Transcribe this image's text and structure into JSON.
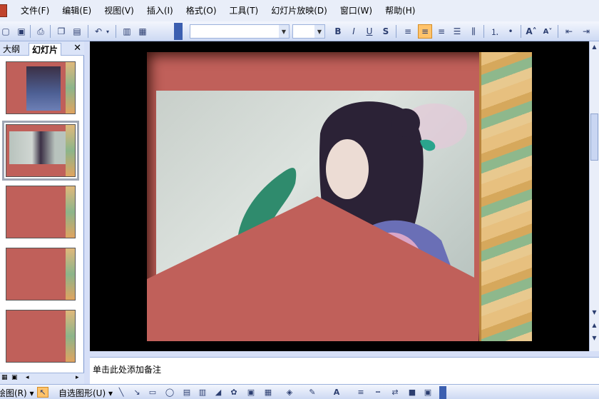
{
  "menubar": {
    "items": [
      "文件(F)",
      "编辑(E)",
      "视图(V)",
      "插入(I)",
      "格式(O)",
      "工具(T)",
      "幻灯片放映(D)",
      "窗口(W)",
      "帮助(H)"
    ]
  },
  "toolbar": {
    "font_name_value": "",
    "font_size_value": "",
    "buttons": [
      "new-icon",
      "open-icon",
      "print-icon",
      "copy-icon",
      "paste-icon",
      "undo-icon",
      "chart-icon",
      "table-icon",
      "bold-icon",
      "italic-icon",
      "underline-icon",
      "shadow-icon",
      "align-left-icon",
      "align-center-icon",
      "align-right-icon",
      "justify-icon",
      "distribute-icon",
      "numbering-icon",
      "bullets-icon",
      "increase-font-icon",
      "decrease-font-icon",
      "decrease-indent-icon",
      "increase-indent-icon"
    ],
    "bold": "B",
    "italic": "I",
    "underline": "U",
    "shadow": "S",
    "active_button": "align-center-icon"
  },
  "left_panel": {
    "tab_outline": "大纲",
    "tab_slides": "幻灯片",
    "close": "✕",
    "thumbnails": [
      {
        "index": 1,
        "has_photo": true
      },
      {
        "index": 2,
        "has_photo": true,
        "selected": true
      },
      {
        "index": 3,
        "has_photo": false
      },
      {
        "index": 4,
        "has_photo": false
      },
      {
        "index": 5,
        "has_photo": false
      }
    ]
  },
  "notes": {
    "placeholder": "单击此处添加备注"
  },
  "drawbar": {
    "draw_label": "绘图(R) ▾",
    "autoshape_label": "自选图形(U) ▾"
  },
  "colors": {
    "slide_background": "#c0605a",
    "editor_background": "#000000",
    "ui_blue": "#d6dff7",
    "active_button": "#ffc36b"
  }
}
